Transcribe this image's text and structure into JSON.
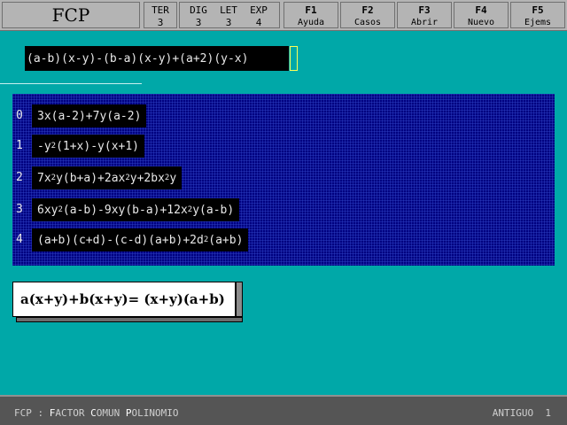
{
  "app": {
    "title": "FCP"
  },
  "stats": [
    {
      "label": "TER",
      "value": "3"
    },
    {
      "label": "DIG",
      "value": "3"
    },
    {
      "label": "LET",
      "value": "3"
    },
    {
      "label": "EXP",
      "value": "4"
    }
  ],
  "fkeys": [
    {
      "key": "F1",
      "label": "Ayuda"
    },
    {
      "key": "F2",
      "label": "Casos"
    },
    {
      "key": "F3",
      "label": "Abrir"
    },
    {
      "key": "F4",
      "label": "Nuevo"
    },
    {
      "key": "F5",
      "label": "Ejems"
    }
  ],
  "input": {
    "value": "(a-b)(x-y)-(b-a)(x-y)+(a+2)(y-x)"
  },
  "cases": [
    {
      "index": "0",
      "parts": [
        "3x(a-2)+7y(a-2)"
      ]
    },
    {
      "index": "1",
      "parts": [
        "-y",
        "2",
        "(1+x)-y(x+1)"
      ]
    },
    {
      "index": "2",
      "parts": [
        "7x",
        "2",
        "y(b+a)+2ax",
        "2",
        "y+2bx",
        "2",
        "y"
      ]
    },
    {
      "index": "3",
      "parts": [
        "6xy",
        "2",
        "(a-b)-9xy(b-a)+12x",
        "2",
        "y(a-b)"
      ]
    },
    {
      "index": "4",
      "parts": [
        "(a+b)(c+d)-(c-d)(a+b)+2d",
        "2",
        "(a+b)"
      ]
    }
  ],
  "example": {
    "text": "a(x+y)+b(x+y)=  (x+y)(a+b)"
  },
  "status": {
    "left": [
      {
        "text": "FCP",
        "hl": false
      },
      {
        "text": " : ",
        "hl": false
      },
      {
        "text": "F",
        "hl": true
      },
      {
        "text": "ACTOR ",
        "hl": false
      },
      {
        "text": "C",
        "hl": true
      },
      {
        "text": "OMUN ",
        "hl": false
      },
      {
        "text": "P",
        "hl": true
      },
      {
        "text": "OLINOMIO",
        "hl": false
      }
    ],
    "right_label": "ANTIGUO",
    "right_value": "1"
  },
  "colors": {
    "background": "#00a8a8",
    "panel": "#000080",
    "toolbar": "#b4b4b4",
    "statusbar": "#555555",
    "cursor": "#ffff55"
  }
}
